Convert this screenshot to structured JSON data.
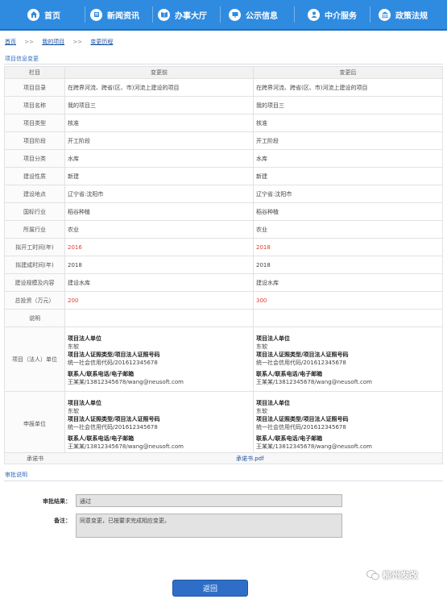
{
  "nav": [
    {
      "label": "首页",
      "icon": "home-icon"
    },
    {
      "label": "新闻资讯",
      "icon": "news-icon"
    },
    {
      "label": "办事大厅",
      "icon": "book-icon"
    },
    {
      "label": "公示信息",
      "icon": "board-icon"
    },
    {
      "label": "中介服务",
      "icon": "user-icon"
    },
    {
      "label": "政策法规",
      "icon": "building-icon"
    }
  ],
  "breadcrumb": {
    "home": "首页",
    "sep": ">>",
    "project": "我的项目",
    "history": "变更历程"
  },
  "section_title": "项目信息变更",
  "table": {
    "headers": {
      "field": "栏目",
      "before": "变更前",
      "after": "变更后"
    },
    "rows": [
      {
        "label": "项目目录",
        "before": "在跨界河流、跨省(区、市)河流上建设的项目",
        "after": "在跨界河流、跨省(区、市)河流上建设的项目",
        "red": false
      },
      {
        "label": "项目名称",
        "before": "我的项目三",
        "after": "我的项目三",
        "red": false
      },
      {
        "label": "项目类型",
        "before": "核准",
        "after": "核准",
        "red": false
      },
      {
        "label": "项目阶段",
        "before": "开工阶段",
        "after": "开工阶段",
        "red": false
      },
      {
        "label": "项目分类",
        "before": "水库",
        "after": "水库",
        "red": false
      },
      {
        "label": "建设性质",
        "before": "新建",
        "after": "新建",
        "red": false
      },
      {
        "label": "建设地点",
        "before": "辽宁省:沈阳市",
        "after": "辽宁省:沈阳市",
        "red": false
      },
      {
        "label": "国标行业",
        "before": "稻谷种植",
        "after": "稻谷种植",
        "red": false
      },
      {
        "label": "所属行业",
        "before": "农业",
        "after": "农业",
        "red": false
      },
      {
        "label": "拟开工时间(年)",
        "before": "2016",
        "after": "2018",
        "red": true
      },
      {
        "label": "拟建成时间(年)",
        "before": "2018",
        "after": "2018",
        "red": false
      },
      {
        "label": "建设规模及内容",
        "before": "建设水库",
        "after": "建设水库",
        "red": false
      },
      {
        "label": "总投资（万元）",
        "before": "200",
        "after": "300",
        "red": true
      },
      {
        "label": "说明",
        "before": "",
        "after": "",
        "red": false
      }
    ],
    "legal": {
      "label": "项目（法人）单位",
      "unit_title": "项目法人单位",
      "unit": "东软",
      "cert_title": "项目法人证照类型/项目法人证照号码",
      "cert": "统一社会信用代码/201612345678",
      "contact_title": "联系人/联系电话/电子邮箱",
      "contact": "王某某/13812345678/wang@neusoft.com"
    },
    "declare": {
      "label": "申报单位",
      "unit_title": "项目法人单位",
      "unit": "东软",
      "cert_title": "项目法人证照类型/项目法人证照号码",
      "cert": "统一社会信用代码/201612345678",
      "contact_title": "联系人/联系电话/电子邮箱",
      "contact": "王某某/13812345678/wang@neusoft.com"
    }
  },
  "promise": {
    "label": "承诺书",
    "link": "承诺书.pdf"
  },
  "approval": {
    "title": "审批说明",
    "result_label": "审批结果：",
    "result_value": "通过",
    "remark_label": "备注：",
    "remark_value": "同意变更，已按要求完成相应变更。"
  },
  "back_label": "返回",
  "watermark": "柳州发改"
}
